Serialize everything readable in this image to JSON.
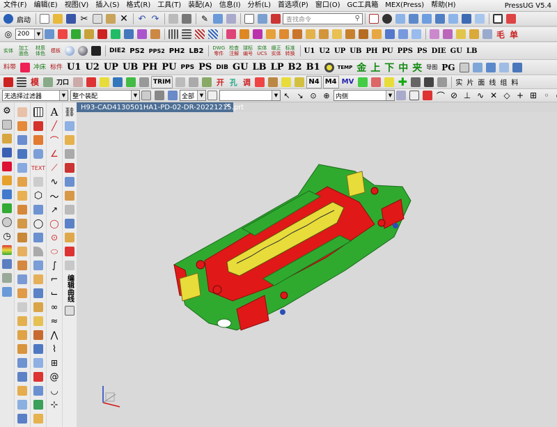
{
  "app": {
    "brand": "PressUG V5.4"
  },
  "menu": [
    "文件(F)",
    "编辑(E)",
    "视图(V)",
    "插入(S)",
    "格式(R)",
    "工具(T)",
    "装配(A)",
    "信息(I)",
    "分析(L)",
    "首选项(P)",
    "窗口(O)",
    "GC工具箱",
    "MEX(Press)",
    "帮助(H)"
  ],
  "toolbar1": {
    "start_label": "启动",
    "search_placeholder": "查找命令"
  },
  "toolbar2": {
    "zoom_value": "200"
  },
  "toolbar3": {
    "labels": [
      "实体",
      "加工面色",
      "材质体色",
      "模板",
      "DIE2",
      "PS2",
      "PPS2",
      "PH2",
      "LB2"
    ],
    "pairs": [
      {
        "a": "DWG",
        "b": "零件"
      },
      {
        "a": "检查",
        "b": "注解"
      },
      {
        "a": "球标",
        "b": "编号"
      },
      {
        "a": "实体",
        "b": "UCS"
      },
      {
        "a": "缀正",
        "b": "实体"
      },
      {
        "a": "标准",
        "b": "转换"
      }
    ],
    "right_labels": [
      "U1",
      "U2",
      "UP",
      "UB",
      "PH",
      "PU",
      "PPS",
      "PS",
      "DIE",
      "GU",
      "LB"
    ]
  },
  "toolbar4": {
    "labels": [
      "料带",
      "冲床",
      "标件",
      "U1",
      "U2",
      "UP",
      "UB",
      "PH",
      "PU",
      "PPS",
      "PS",
      "DIB",
      "GU",
      "LB",
      "LP",
      "B2",
      "B1",
      "TEMP"
    ],
    "cn_big": [
      "金",
      "上",
      "下",
      "中",
      "夹"
    ],
    "small": [
      "导图",
      "PG"
    ]
  },
  "toolbar5": {
    "labels": [
      "刀口",
      "TRIM",
      "M4",
      "N4",
      "MV"
    ],
    "right_text": [
      "实",
      "片",
      "面",
      "线",
      "组",
      "料"
    ]
  },
  "toolbar6": {
    "filter": "无选择过滤器",
    "assembly": "整个装配",
    "scope": "全部",
    "position": "内侧"
  },
  "file_tab": {
    "title": "H93-CAD4130501HA1-PD-02-DR-20221215.prt"
  },
  "side_panel": {
    "vertical_label": "编辑曲线"
  },
  "colors": {
    "red": "#e01818",
    "green": "#2faa2f",
    "yellow": "#e8dc3a",
    "tab": "#4d6f95"
  }
}
